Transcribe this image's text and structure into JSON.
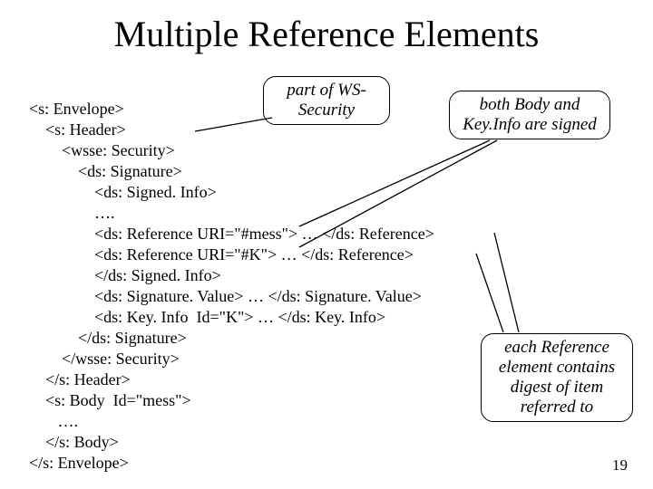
{
  "title": "Multiple Reference Elements",
  "code": {
    "l1": "<s: Envelope>",
    "l2": "    <s: Header>",
    "l3": "        <wsse: Security>",
    "l4": "            <ds: Signature>",
    "l5": "                <ds: Signed. Info>",
    "l6": "                …. ",
    "l7": "                <ds: Reference URI=\"#mess\"> … </ds: Reference>",
    "l8": "                <ds: Reference URI=\"#K\"> … </ds: Reference>",
    "l9": "                </ds: Signed. Info>",
    "l10": "                <ds: Signature. Value> … </ds: Signature. Value>",
    "l11": "                <ds: Key. Info  Id=\"K\"> … </ds: Key. Info>",
    "l12": "            </ds: Signature>",
    "l13": "        </wsse: Security>",
    "l14": "    </s: Header>",
    "l15": "    <s: Body  Id=\"mess\">",
    "l16": "       …. ",
    "l17": "    </s: Body>",
    "l18": "</s: Envelope>"
  },
  "callouts": {
    "ws": "part of  WS-\nSecurity",
    "both": "both Body and\nKey.Info are signed",
    "each": "each Reference\nelement contains\ndigest of item\nreferred to"
  },
  "page_number": "19"
}
